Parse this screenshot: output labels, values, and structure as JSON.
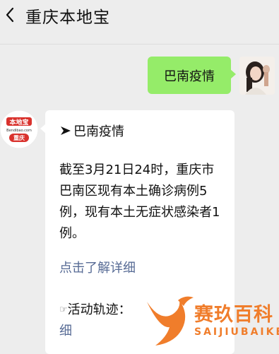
{
  "header": {
    "title": "重庆本地宝",
    "back_icon": "chevron-left-icon"
  },
  "messages": {
    "sent": {
      "text": "巴南疫情"
    },
    "received": {
      "heading": "巴南疫情",
      "body": "截至3月21日24时，重庆市巴南区现有本土确诊病例5例，现有本土无症状感染者1例。",
      "link": "点击了解详细",
      "track_label": "活动轨迹：",
      "track_link_tail": "细"
    }
  },
  "bot_avatar": {
    "brand": "本地宝",
    "site": "Bendibao.com",
    "city": "重庆"
  },
  "watermark": {
    "cn": "赛玖百科",
    "en": "SAIJIUBAIKE"
  },
  "colors": {
    "background": "#ededed",
    "sent_bubble": "#95ec69",
    "link": "#576b95",
    "brand_red": "#d9322d",
    "watermark": "#f07d2b"
  }
}
